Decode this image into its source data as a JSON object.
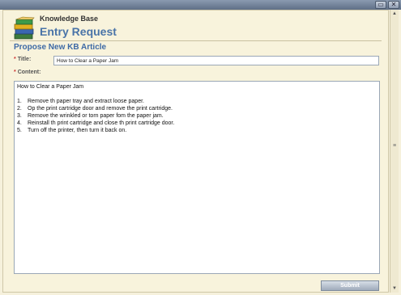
{
  "header": {
    "app_name": "Knowledge Base",
    "title": "Entry Request"
  },
  "form": {
    "section_title": "Propose New KB Article",
    "required_mark": "*",
    "title_label": "Title:",
    "title_value": "How to Clear a Paper Jam",
    "content_label": "Content:",
    "content": {
      "heading": "How to Clear a Paper Jam",
      "steps": [
        {
          "num": "1.",
          "text": "Remove th paper tray and extract loose paper."
        },
        {
          "num": "2.",
          "text": "Op the print cartridge door and remove the print cartridge."
        },
        {
          "num": "3.",
          "text": "Remove the wrinkled or torn paper fom the paper jam."
        },
        {
          "num": "4.",
          "text": "Reinstall th print cartridge and close th print cartridge door."
        },
        {
          "num": "5.",
          "text": "Turn off the printer, then turn it back on."
        }
      ]
    },
    "submit_label": "Submit"
  },
  "window": {
    "minimize_glyph": "▭",
    "close_glyph": "✕"
  },
  "icons": {
    "header": "books-stack-icon",
    "scroll_up": "arrow-up-icon",
    "scroll_down": "arrow-down-icon"
  },
  "colors": {
    "title_blue": "#4a74a8",
    "required_red": "#cc3333",
    "background": "#f8f3dc"
  }
}
